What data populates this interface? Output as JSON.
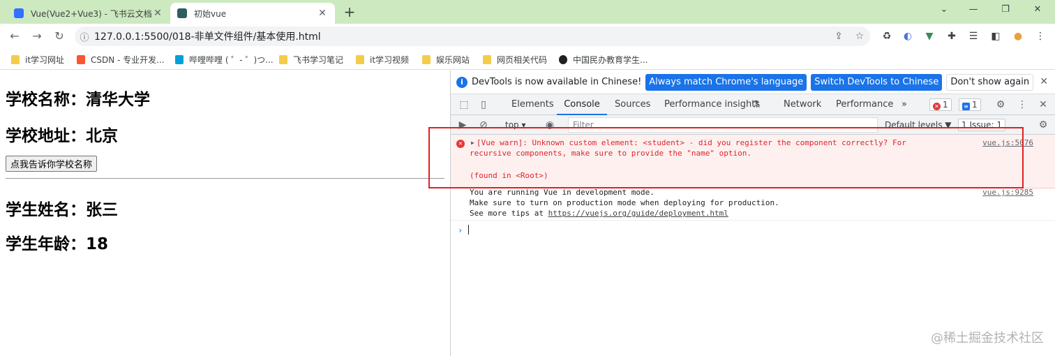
{
  "browser": {
    "tabs": [
      {
        "title": "Vue(Vue2+Vue3) - 飞书云文档",
        "close": "✕"
      },
      {
        "title": "初始vue",
        "close": "✕"
      }
    ],
    "new_tab": "+",
    "window_controls": {
      "minimize": "⌄",
      "restore": "❐",
      "close": "✕"
    },
    "url": "127.0.0.1:5500/018-非单文件组件/基本使用.html",
    "bookmarks": [
      "it学习网址",
      "CSDN - 专业开发...",
      "哔哩哔哩 ( ゜- ゜)つ...",
      "飞书学习笔记",
      "it学习视频",
      "娱乐网站",
      "网页相关代码",
      "中国民办教育学生..."
    ]
  },
  "page": {
    "school_name": "学校名称：清华大学",
    "school_address": "学校地址：北京",
    "button_label": "点我告诉你学校名称",
    "student_name": "学生姓名：张三",
    "student_age": "学生年龄：18"
  },
  "devtools": {
    "infobar": {
      "message": "DevTools is now available in Chinese!",
      "primary_button": "Always match Chrome's language",
      "secondary_button": "Switch DevTools to Chinese",
      "dismiss_button": "Don't show again"
    },
    "tabs": [
      "Elements",
      "Console",
      "Sources",
      "Performance insights",
      "Network",
      "Performance",
      "»"
    ],
    "active_tab": "Console",
    "error_count": "1",
    "message_count": "1",
    "context": "top",
    "filter_placeholder": "Filter",
    "levels": "Default levels ▼",
    "issues": "1 Issue: 1",
    "console": {
      "warning_line1": "[Vue warn]: Unknown custom element: <student> - did you register the component correctly? For",
      "warning_line2": "recursive components, make sure to provide the \"name\" option.",
      "warning_line3": "(found in <Root>)",
      "warning_source": "vue.js:5076",
      "log_line1": "You are running Vue in development mode.",
      "log_line2": "Make sure to turn on production mode when deploying for production.",
      "log_line3_prefix": "See more tips at ",
      "log_link": "https://vuejs.org/guide/deployment.html",
      "log_source": "vue.js:9285",
      "prompt": "›"
    }
  },
  "watermark": "@稀土掘金技术社区",
  "colors": {
    "tab_strip": "#cde9c0",
    "accent": "#1a73e8",
    "error": "#d9262c",
    "highlight_box": "#e02020"
  }
}
